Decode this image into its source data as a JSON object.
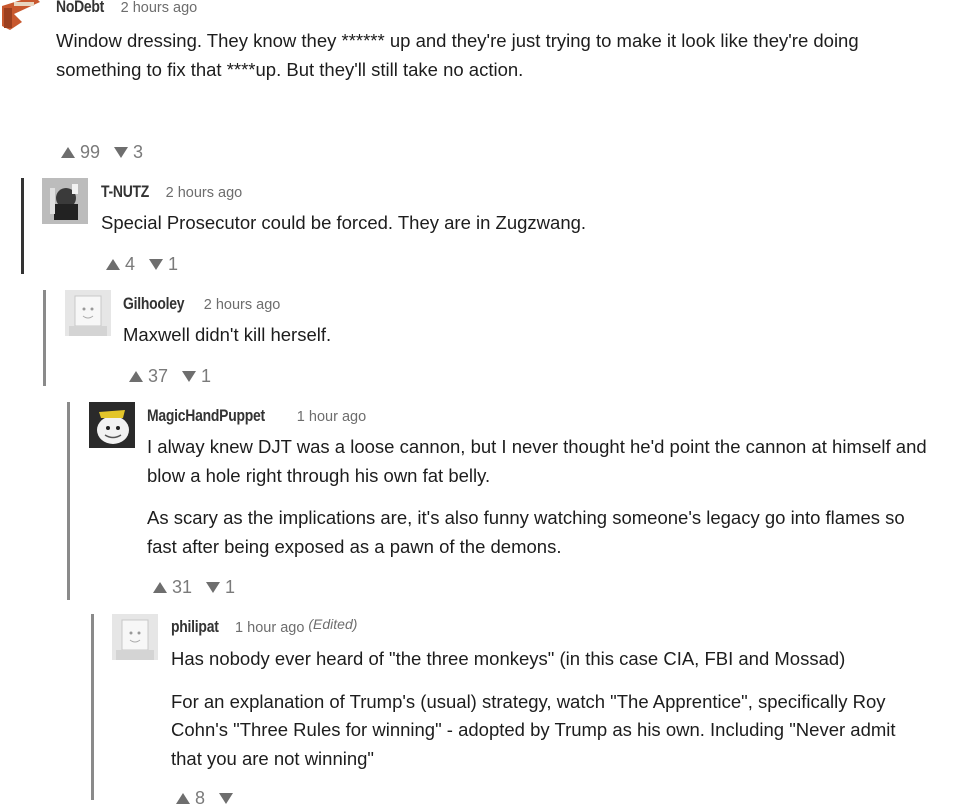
{
  "comments": [
    {
      "username": "NoDebt",
      "time": "2 hours ago",
      "edited": "",
      "paragraphs": [
        "Window dressing.  They know they ****** up and they're just trying to make it look like they're doing something to fix that ****up.  But they'll still take no action."
      ],
      "upvotes": "99",
      "downvotes": "3"
    },
    {
      "username": "T-NUTZ",
      "time": "2 hours ago",
      "edited": "",
      "paragraphs": [
        "Special Prosecutor could be forced.   They are in Zugzwang."
      ],
      "upvotes": "4",
      "downvotes": "1"
    },
    {
      "username": "Gilhooley",
      "time": "2 hours ago",
      "edited": "",
      "paragraphs": [
        "Maxwell didn't kill herself."
      ],
      "upvotes": "37",
      "downvotes": "1"
    },
    {
      "username": "MagicHandPuppet",
      "time": "1 hour ago",
      "edited": "",
      "paragraphs": [
        "I alway knew DJT was a loose cannon, but I never thought he'd point the cannon at himself and blow a hole right through his own fat belly.",
        "As scary as the implications are, it's also funny watching someone's legacy go into flames so fast after being exposed as a pawn of the demons."
      ],
      "upvotes": "31",
      "downvotes": "1"
    },
    {
      "username": "philipat",
      "time": "1 hour ago",
      "edited": "(Edited)",
      "paragraphs": [
        "Has nobody ever heard of \"the three monkeys\" (in this case CIA, FBI and Mossad)",
        "For an explanation of Trump's (usual) strategy, watch \"The Apprentice\", specifically Roy Cohn's \"Three Rules for winning\" - adopted by Trump as his own. Including \"Never admit that you are not winning\""
      ],
      "upvotes": "8",
      "downvotes": ""
    }
  ]
}
